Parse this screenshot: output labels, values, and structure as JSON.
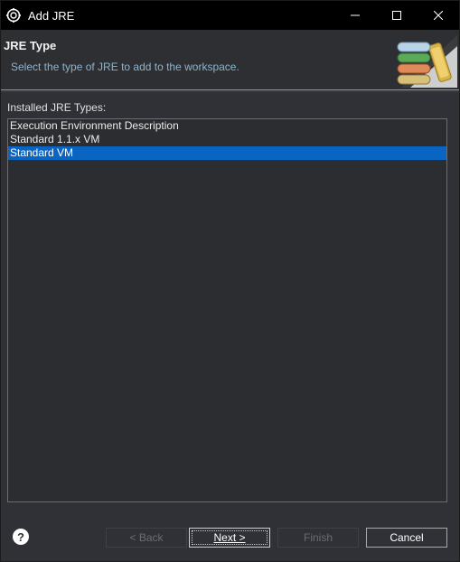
{
  "window": {
    "title": "Add JRE"
  },
  "header": {
    "title": "JRE Type",
    "description": "Select the type of JRE to add to the workspace."
  },
  "main": {
    "list_label": "Installed JRE Types:",
    "items": [
      {
        "label": "Execution Environment Description",
        "selected": false
      },
      {
        "label": "Standard 1.1.x VM",
        "selected": false
      },
      {
        "label": "Standard VM",
        "selected": true
      }
    ]
  },
  "footer": {
    "help": "?",
    "back": "< Back",
    "next": "Next >",
    "finish": "Finish",
    "cancel": "Cancel"
  },
  "colors": {
    "selection": "#0a64c2",
    "titlebar": "#000000",
    "description": "#8fb3c9"
  },
  "icons": {
    "app": "eclipse-gear-icon",
    "banner": "jre-libraries-banner-icon"
  }
}
